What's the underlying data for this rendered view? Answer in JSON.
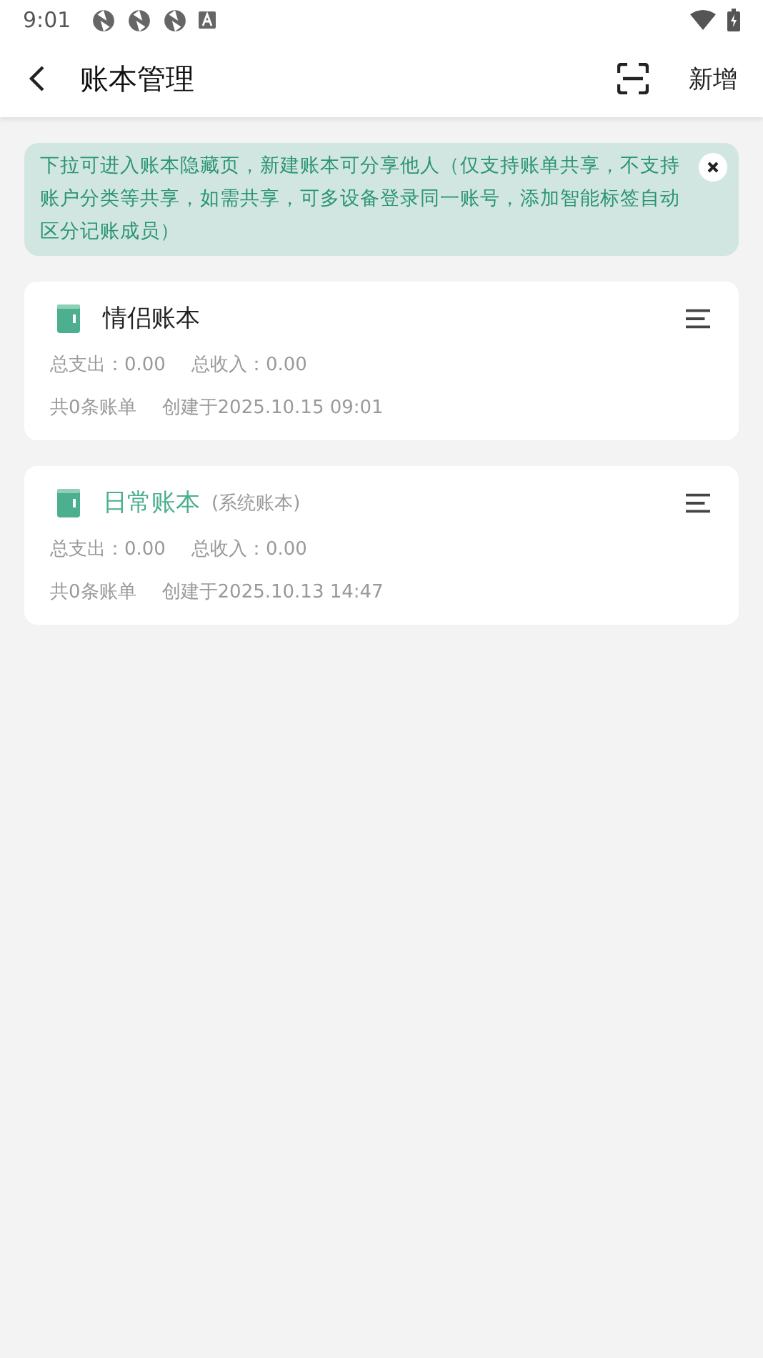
{
  "status_bar": {
    "time": "9:01"
  },
  "header": {
    "title": "账本管理",
    "action": "新增"
  },
  "notice": {
    "text": "下拉可进入账本隐藏页，新建账本可分享他人（仅支持账单共享，不支持账户分类等共享，如需共享，可多设备登录同一账号，添加智能标签自动区分记账成员）"
  },
  "books": [
    {
      "name": "情侣账本",
      "selected": false,
      "expense": "总支出：0.00",
      "income": "总收入：0.00",
      "count": "共0条账单",
      "created": "创建于2025.10.15 09:01"
    },
    {
      "name": "日常账本",
      "tag": "(系统账本)",
      "selected": true,
      "expense": "总支出：0.00",
      "income": "总收入：0.00",
      "count": "共0条账单",
      "created": "创建于2025.10.13 14:47"
    }
  ]
}
